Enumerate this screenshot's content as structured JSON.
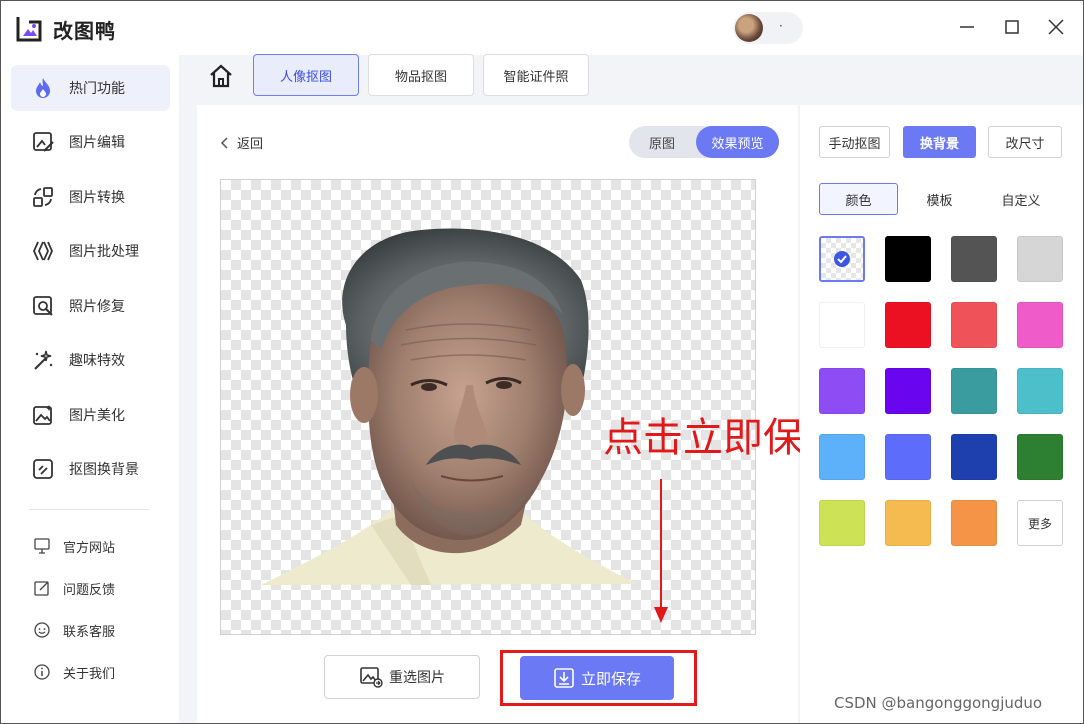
{
  "app": {
    "name": "改图鸭",
    "user_name": "·"
  },
  "sidebar": {
    "items": [
      {
        "label": "热门功能",
        "icon": "flame-icon"
      },
      {
        "label": "图片编辑",
        "icon": "image-edit-icon"
      },
      {
        "label": "图片转换",
        "icon": "convert-icon"
      },
      {
        "label": "图片批处理",
        "icon": "batch-icon"
      },
      {
        "label": "照片修复",
        "icon": "photo-repair-icon"
      },
      {
        "label": "趣味特效",
        "icon": "magic-wand-icon"
      },
      {
        "label": "图片美化",
        "icon": "beautify-icon"
      },
      {
        "label": "抠图换背景",
        "icon": "cutout-icon"
      }
    ],
    "links": [
      {
        "label": "官方网站",
        "icon": "monitor-icon"
      },
      {
        "label": "问题反馈",
        "icon": "feedback-icon"
      },
      {
        "label": "联系客服",
        "icon": "support-icon"
      },
      {
        "label": "关于我们",
        "icon": "info-icon"
      }
    ]
  },
  "tabs": [
    {
      "label": "人像抠图",
      "active": true
    },
    {
      "label": "物品抠图",
      "active": false
    },
    {
      "label": "智能证件照",
      "active": false
    }
  ],
  "main": {
    "back_label": "返回",
    "view_toggle": {
      "original": "原图",
      "preview": "效果预览",
      "selected": "效果预览"
    },
    "reselect_label": "重选图片",
    "save_label": "立即保存"
  },
  "annotation": {
    "text": "点击立即保存",
    "color": "#e0191a"
  },
  "right": {
    "mode_buttons": [
      {
        "label": "手动抠图",
        "active": false
      },
      {
        "label": "换背景",
        "active": true
      },
      {
        "label": "改尺寸",
        "active": false
      }
    ],
    "sub_tabs": [
      {
        "label": "颜色",
        "active": true
      },
      {
        "label": "模板",
        "active": false
      },
      {
        "label": "自定义",
        "active": false
      }
    ],
    "swatches": [
      "transparent",
      "#000000",
      "#545454",
      "#d6d6d6",
      "#ffffff",
      "#ec1023",
      "#ef5258",
      "#ef5cca",
      "#8e4cf4",
      "#6a05ef",
      "#3a9c9e",
      "#4dbfca",
      "#5db1fb",
      "#5d6cfb",
      "#1e3fae",
      "#2d7f31",
      "#cde255",
      "#f5bb51",
      "#f59446"
    ],
    "selected_swatch": "transparent",
    "more_label": "更多"
  },
  "accent_color": "#6b7af4",
  "watermark": "CSDN @bangonggongjuduo"
}
